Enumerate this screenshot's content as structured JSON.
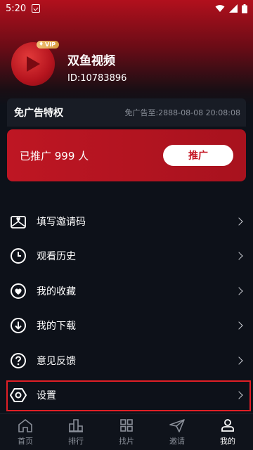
{
  "status_bar": {
    "time": "5:20"
  },
  "profile": {
    "vip_label": "VIP",
    "app_name": "双鱼视频",
    "user_id": "ID:10783896"
  },
  "privilege": {
    "title": "免广告特权",
    "expire_text": "免广告至:2888-08-08 20:08:08"
  },
  "promo": {
    "count_text": "已推广 999 人",
    "button_label": "推广"
  },
  "menu": {
    "items": [
      {
        "label": "填写邀请码",
        "icon": "invite-code-icon"
      },
      {
        "label": "观看历史",
        "icon": "clock-icon"
      },
      {
        "label": "我的收藏",
        "icon": "heart-icon"
      },
      {
        "label": "我的下载",
        "icon": "download-icon"
      },
      {
        "label": "意见反馈",
        "icon": "question-icon"
      },
      {
        "label": "设置",
        "icon": "hexagon-settings-icon"
      }
    ]
  },
  "nav": {
    "items": [
      {
        "label": "首页",
        "icon": "home-icon"
      },
      {
        "label": "排行",
        "icon": "ranking-icon"
      },
      {
        "label": "找片",
        "icon": "grid-icon"
      },
      {
        "label": "邀请",
        "icon": "send-icon"
      },
      {
        "label": "我的",
        "icon": "user-icon",
        "active": true
      }
    ]
  },
  "colors": {
    "accent": "#c3121f",
    "highlight_border": "#e01f26",
    "background": "#0d1119"
  }
}
